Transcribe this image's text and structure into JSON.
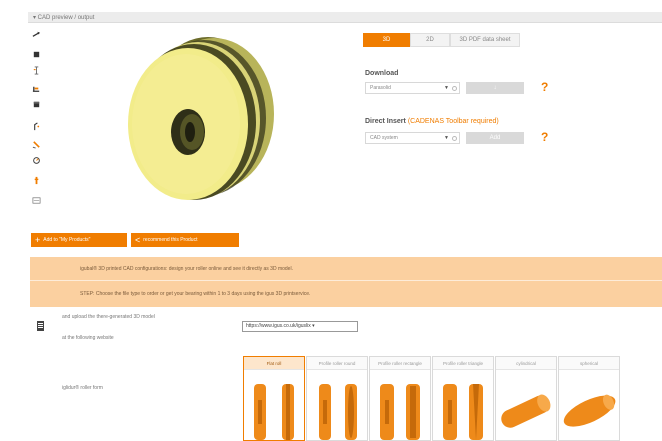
{
  "panel": {
    "title": "▾ CAD preview / output"
  },
  "toolbar": {
    "icons": [
      "rotate-icon",
      "cube-icon",
      "dimension-icon",
      "measure-icon",
      "cube-solid-icon",
      "edit-icon",
      "pencil-icon",
      "refresh-icon",
      "info-icon",
      "zoom-fit-icon"
    ]
  },
  "tabs": [
    {
      "label": "3D",
      "active": true
    },
    {
      "label": "2D",
      "active": false
    },
    {
      "label": "3D PDF data sheet",
      "active": false
    }
  ],
  "download": {
    "label": "Download",
    "format_value": "Parasolid",
    "button_label": "↓"
  },
  "direct_insert": {
    "label": "Direct Insert",
    "hint": "(CADENAS Toolbar required)",
    "cad_value": "CAD system",
    "button_label": "Add"
  },
  "actions": {
    "add_label": "Add to \"My Products\"",
    "recommend_label": "recommend this Product"
  },
  "info_band": {
    "line1": "igubal® 3D printed CAD configurations: design your roller online and see it directly as 3D model.",
    "line2": "STEP: Choose the file type to order or get your bearing within 1 to 3 days using the igus 3D printservice."
  },
  "upload": {
    "text1": "and upload the there-generated 3D model",
    "text2": "at the following website",
    "url_value": "https://www.igus.co.uk/iguslix ▾"
  },
  "roller_form": {
    "label": "iglidur® roller form",
    "options": [
      {
        "label": "Flat roll",
        "selected": true
      },
      {
        "label": "Profile roller round",
        "selected": false
      },
      {
        "label": "Profile roller rectangle",
        "selected": false
      },
      {
        "label": "Profile roller triangle",
        "selected": false
      },
      {
        "label": "cylindrical",
        "selected": false
      },
      {
        "label": "spherical",
        "selected": false
      }
    ]
  },
  "colors": {
    "accent": "#f07d00",
    "band": "#fbd0a0",
    "roller": "#f2ec8a"
  }
}
